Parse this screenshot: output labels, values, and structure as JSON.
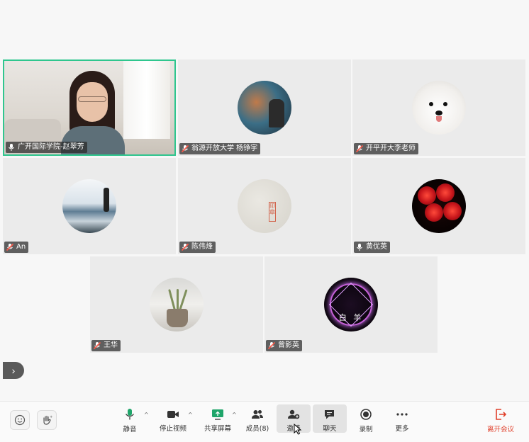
{
  "participants": [
    {
      "name": "广开国际学院-赵翠芳",
      "type": "video",
      "active": true
    },
    {
      "name": "翁源开放大学 杨铮宇",
      "type": "avatar"
    },
    {
      "name": "开平开大李老师",
      "type": "avatar"
    },
    {
      "name": "An",
      "type": "avatar"
    },
    {
      "name": "陈伟烽",
      "type": "avatar"
    },
    {
      "name": "黄优英",
      "type": "avatar"
    },
    {
      "name": "王华",
      "type": "avatar"
    },
    {
      "name": "曾影英",
      "type": "avatar",
      "avatar_text": "白 羊"
    }
  ],
  "toolbar": {
    "mute_label": "静音",
    "stop_video_label": "停止视频",
    "share_screen_label": "共享屏幕",
    "members_label": "成员(8)",
    "invite_label": "邀请",
    "chat_label": "聊天",
    "record_label": "录制",
    "more_label": "更多",
    "leave_label": "离开会议"
  },
  "colors": {
    "active_border": "#2fc68e",
    "leave": "#e03f2a",
    "share_icon": "#1fa56a",
    "mute_icon": "#1fa56a"
  }
}
